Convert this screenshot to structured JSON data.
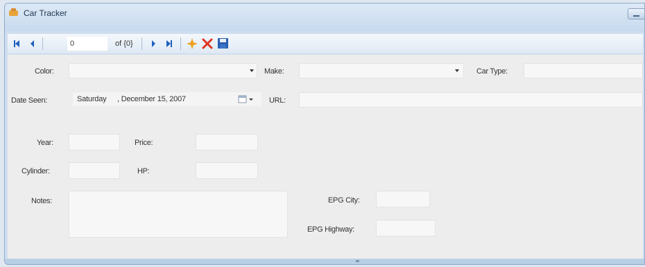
{
  "window": {
    "title": "Car Tracker"
  },
  "toolbar": {
    "position_value": "0",
    "count_label": "of {0}",
    "icons": [
      "move-first-icon",
      "move-previous-icon",
      "move-next-icon",
      "move-last-icon",
      "add-new-icon",
      "delete-icon",
      "save-icon"
    ]
  },
  "form": {
    "color_label": "Color:",
    "make_label": "Make:",
    "car_type_label": "Car Type:",
    "date_seen_label": "Date Seen:",
    "date": {
      "day": "Saturday",
      "rest": ", December 15, 2007"
    },
    "url_label": "URL:",
    "year_label": "Year:",
    "price_label": "Price:",
    "cylinder_label": "Cylinder:",
    "hp_label": "HP:",
    "notes_label": "Notes:",
    "epg_city_label": "EPG City:",
    "epg_highway_label": "EPG Highway:"
  },
  "colors": {
    "accent": "#1f5fbf",
    "delete": "#e0331f",
    "add": "#f0a020"
  }
}
